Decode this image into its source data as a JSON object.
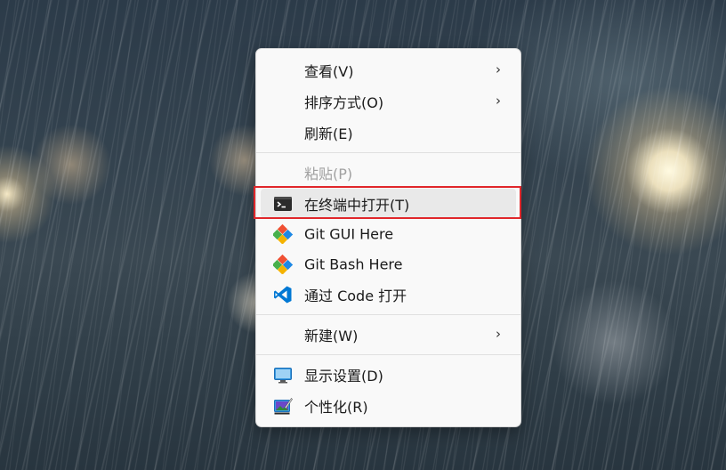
{
  "menu": {
    "items": [
      {
        "label": "查看(V)",
        "icon": "none",
        "submenu": true,
        "disabled": false
      },
      {
        "label": "排序方式(O)",
        "icon": "none",
        "submenu": true,
        "disabled": false
      },
      {
        "label": "刷新(E)",
        "icon": "none",
        "submenu": false,
        "disabled": false
      },
      {
        "label": "粘贴(P)",
        "icon": "none",
        "submenu": false,
        "disabled": true
      },
      {
        "label": "在终端中打开(T)",
        "icon": "terminal-icon",
        "submenu": false,
        "disabled": false,
        "highlighted": true
      },
      {
        "label": "Git GUI Here",
        "icon": "git-icon",
        "submenu": false,
        "disabled": false
      },
      {
        "label": "Git Bash Here",
        "icon": "git-icon",
        "submenu": false,
        "disabled": false
      },
      {
        "label": "通过 Code 打开",
        "icon": "vscode-icon",
        "submenu": false,
        "disabled": false
      },
      {
        "label": "新建(W)",
        "icon": "none",
        "submenu": true,
        "disabled": false
      },
      {
        "label": "显示设置(D)",
        "icon": "display-settings-icon",
        "submenu": false,
        "disabled": false
      },
      {
        "label": "个性化(R)",
        "icon": "personalize-icon",
        "submenu": false,
        "disabled": false
      }
    ],
    "submenu_glyph": "›"
  },
  "colors": {
    "highlight_border": "#e0272b",
    "menu_background": "#f9f9f9",
    "disabled_text": "#a0a0a0",
    "git_orange": "#f05033",
    "git_green": "#47b04b",
    "git_blue": "#1e88e5",
    "vscode_blue": "#0078d4"
  }
}
